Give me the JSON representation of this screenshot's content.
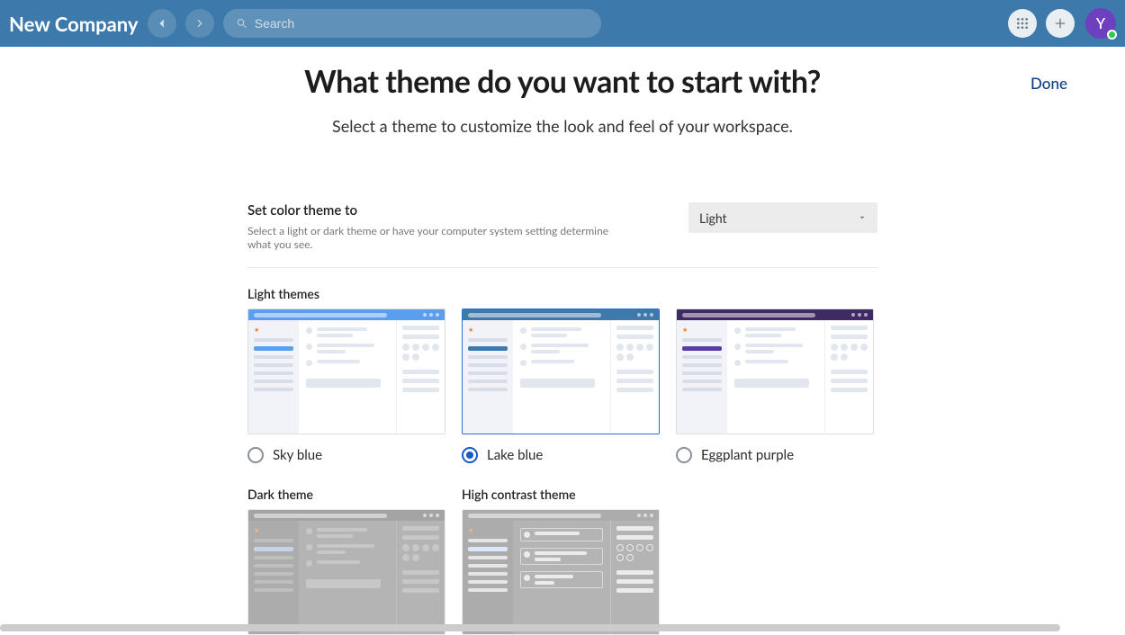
{
  "header": {
    "company": "New Company",
    "search_placeholder": "Search",
    "avatar_initial": "Y"
  },
  "page": {
    "title": "What theme do you want to start with?",
    "subtitle": "Select a theme to customize the look and feel of your workspace.",
    "done_label": "Done"
  },
  "mode": {
    "label": "Set color theme to",
    "help": "Select a light or dark theme or have your computer system setting determine what you see.",
    "selected": "Light"
  },
  "sections": {
    "light_heading": "Light themes",
    "dark_heading": "Dark theme",
    "hc_heading": "High contrast theme"
  },
  "themes": {
    "light": [
      {
        "label": "Sky blue",
        "selected": false
      },
      {
        "label": "Lake blue",
        "selected": true
      },
      {
        "label": "Eggplant purple",
        "selected": false
      }
    ]
  }
}
